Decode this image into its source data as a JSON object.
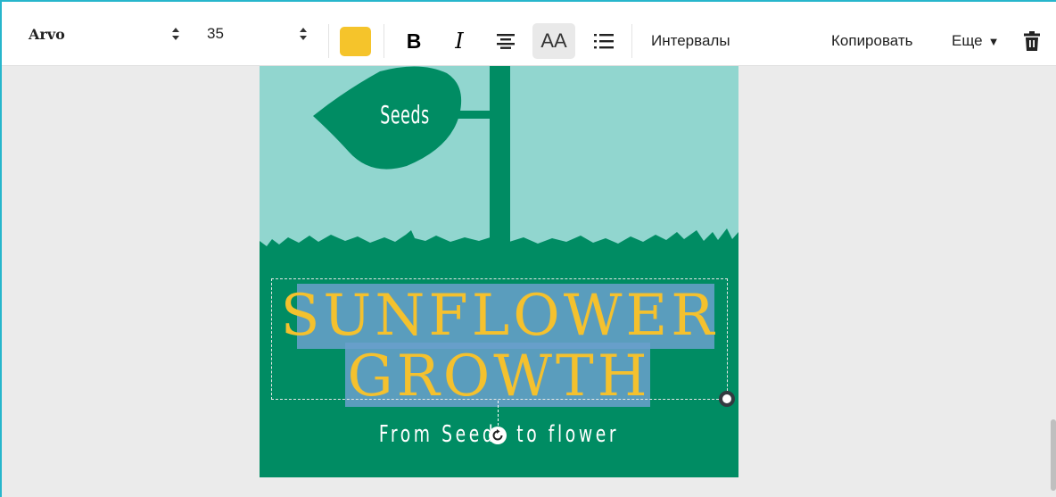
{
  "toolbar": {
    "font_family": "Arvo",
    "font_size": "35",
    "text_color": "#f5c42b",
    "bold_label": "B",
    "italic_label": "I",
    "align_icon": "align-center-icon",
    "case_label": "AA",
    "list_icon": "list-icon",
    "spacing_label": "Интервалы",
    "copy_label": "Копировать",
    "more_label": "Еще",
    "trash_icon": "trash-icon"
  },
  "design": {
    "sign_text": "Seeds",
    "title_line1": "SUNFLOWER",
    "title_line2": "GROWTH",
    "subtitle": "From Seeds to flower",
    "colors": {
      "sky": "#91d6cf",
      "green": "#008c63",
      "title": "#f4c12e",
      "selection": "#6aa0cc"
    }
  }
}
